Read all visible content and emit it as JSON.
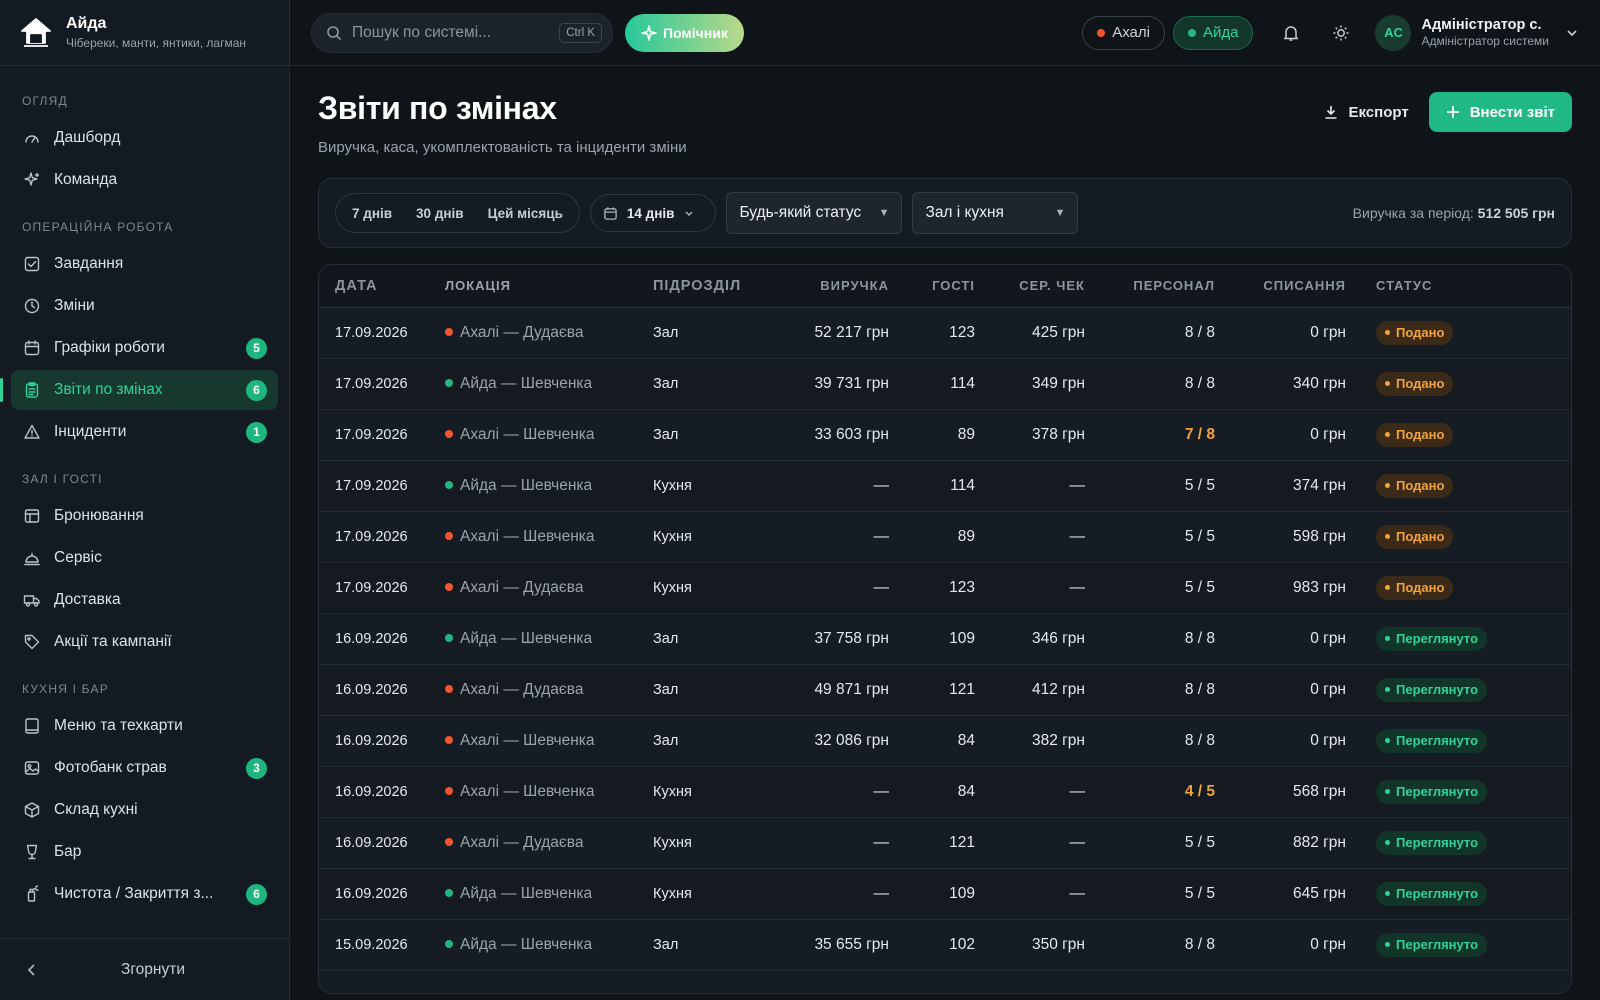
{
  "brand": {
    "name": "Айда",
    "subtitle": "Чібереки, манти, янтики, лагман"
  },
  "search": {
    "placeholder": "Пошук по системі...",
    "shortcut": "Ctrl K"
  },
  "assistant_label": "Помічник",
  "locations": [
    {
      "label": "Ахалі",
      "color": "#f0562e",
      "active": false
    },
    {
      "label": "Айда",
      "color": "#22b57d",
      "active": true
    }
  ],
  "user": {
    "initials": "AC",
    "name": "Адміністратор с.",
    "role": "Адміністратор системи"
  },
  "sidebar": {
    "sections": [
      {
        "title": "ОГЛЯД",
        "items": [
          {
            "label": "Дашборд",
            "icon": "gauge-icon"
          },
          {
            "label": "Команда",
            "icon": "sparkle-icon"
          }
        ]
      },
      {
        "title": "ОПЕРАЦІЙНА РОБОТА",
        "items": [
          {
            "label": "Завдання",
            "icon": "checkbox-icon"
          },
          {
            "label": "Зміни",
            "icon": "clock-icon"
          },
          {
            "label": "Графіки роботи",
            "icon": "calendar-icon",
            "badge": "5"
          },
          {
            "label": "Звіти по змінах",
            "icon": "clipboard-icon",
            "badge": "6",
            "active": true
          },
          {
            "label": "Інциденти",
            "icon": "warning-icon",
            "badge": "1"
          }
        ]
      },
      {
        "title": "ЗАЛ І ГОСТІ",
        "items": [
          {
            "label": "Бронювання",
            "icon": "table-icon"
          },
          {
            "label": "Сервіс",
            "icon": "cloche-icon"
          },
          {
            "label": "Доставка",
            "icon": "truck-icon"
          },
          {
            "label": "Акції та кампанії",
            "icon": "tag-icon"
          }
        ]
      },
      {
        "title": "КУХНЯ І БАР",
        "items": [
          {
            "label": "Меню та техкарти",
            "icon": "book-icon"
          },
          {
            "label": "Фотобанк страв",
            "icon": "image-icon",
            "badge": "3"
          },
          {
            "label": "Склад кухні",
            "icon": "box-icon"
          },
          {
            "label": "Бар",
            "icon": "glass-icon"
          },
          {
            "label": "Чистота / Закриття з...",
            "icon": "spray-icon",
            "badge": "6"
          }
        ]
      }
    ],
    "collapse_label": "Згорнути"
  },
  "page": {
    "title": "Звіти по змінах",
    "subtitle": "Виручка, каса, укомплектованість та інциденти зміни",
    "export_label": "Експорт",
    "primary_label": "Внести звіт"
  },
  "filters": {
    "ranges": [
      "7 днів",
      "30 днів",
      "Цей місяць"
    ],
    "date_value": "14 днів",
    "status_value": "Будь-який статус",
    "dept_value": "Зал і кухня",
    "summary_label": "Виручка за період:",
    "summary_value": "512 505 грн"
  },
  "table": {
    "headers": [
      "ДАТА",
      "ЛОКАЦІЯ",
      "ПІДРОЗДІЛ",
      "ВИРУЧКА",
      "ГОСТІ",
      "СЕР. ЧЕК",
      "ПЕРСОНАЛ",
      "СПИСАННЯ",
      "СТАТУС"
    ],
    "rows": [
      {
        "date": "17.09.2026",
        "loc": "Ахалі — Дудаєва",
        "loc_color": "#f0562e",
        "dept": "Зал",
        "revenue": "52 217 грн",
        "guests": "123",
        "check": "425 грн",
        "staff": "8 / 8",
        "staff_warn": false,
        "writeoff": "0 грн",
        "status": "Подано",
        "status_kind": "submitted"
      },
      {
        "date": "17.09.2026",
        "loc": "Айда — Шевченка",
        "loc_color": "#22b57d",
        "dept": "Зал",
        "revenue": "39 731 грн",
        "guests": "114",
        "check": "349 грн",
        "staff": "8 / 8",
        "staff_warn": false,
        "writeoff": "340 грн",
        "status": "Подано",
        "status_kind": "submitted"
      },
      {
        "date": "17.09.2026",
        "loc": "Ахалі — Шевченка",
        "loc_color": "#f0562e",
        "dept": "Зал",
        "revenue": "33 603 грн",
        "guests": "89",
        "check": "378 грн",
        "staff": "7 / 8",
        "staff_warn": true,
        "writeoff": "0 грн",
        "status": "Подано",
        "status_kind": "submitted"
      },
      {
        "date": "17.09.2026",
        "loc": "Айда — Шевченка",
        "loc_color": "#22b57d",
        "dept": "Кухня",
        "revenue": "—",
        "guests": "114",
        "check": "—",
        "staff": "5 / 5",
        "staff_warn": false,
        "writeoff": "374 грн",
        "status": "Подано",
        "status_kind": "submitted"
      },
      {
        "date": "17.09.2026",
        "loc": "Ахалі — Шевченка",
        "loc_color": "#f0562e",
        "dept": "Кухня",
        "revenue": "—",
        "guests": "89",
        "check": "—",
        "staff": "5 / 5",
        "staff_warn": false,
        "writeoff": "598 грн",
        "status": "Подано",
        "status_kind": "submitted"
      },
      {
        "date": "17.09.2026",
        "loc": "Ахалі — Дудаєва",
        "loc_color": "#f0562e",
        "dept": "Кухня",
        "revenue": "—",
        "guests": "123",
        "check": "—",
        "staff": "5 / 5",
        "staff_warn": false,
        "writeoff": "983 грн",
        "status": "Подано",
        "status_kind": "submitted"
      },
      {
        "date": "16.09.2026",
        "loc": "Айда — Шевченка",
        "loc_color": "#22b57d",
        "dept": "Зал",
        "revenue": "37 758 грн",
        "guests": "109",
        "check": "346 грн",
        "staff": "8 / 8",
        "staff_warn": false,
        "writeoff": "0 грн",
        "status": "Переглянуто",
        "status_kind": "reviewed"
      },
      {
        "date": "16.09.2026",
        "loc": "Ахалі — Дудаєва",
        "loc_color": "#f0562e",
        "dept": "Зал",
        "revenue": "49 871 грн",
        "guests": "121",
        "check": "412 грн",
        "staff": "8 / 8",
        "staff_warn": false,
        "writeoff": "0 грн",
        "status": "Переглянуто",
        "status_kind": "reviewed"
      },
      {
        "date": "16.09.2026",
        "loc": "Ахалі — Шевченка",
        "loc_color": "#f0562e",
        "dept": "Зал",
        "revenue": "32 086 грн",
        "guests": "84",
        "check": "382 грн",
        "staff": "8 / 8",
        "staff_warn": false,
        "writeoff": "0 грн",
        "status": "Переглянуто",
        "status_kind": "reviewed"
      },
      {
        "date": "16.09.2026",
        "loc": "Ахалі — Шевченка",
        "loc_color": "#f0562e",
        "dept": "Кухня",
        "revenue": "—",
        "guests": "84",
        "check": "—",
        "staff": "4 / 5",
        "staff_warn": true,
        "writeoff": "568 грн",
        "status": "Переглянуто",
        "status_kind": "reviewed"
      },
      {
        "date": "16.09.2026",
        "loc": "Ахалі — Дудаєва",
        "loc_color": "#f0562e",
        "dept": "Кухня",
        "revenue": "—",
        "guests": "121",
        "check": "—",
        "staff": "5 / 5",
        "staff_warn": false,
        "writeoff": "882 грн",
        "status": "Переглянуто",
        "status_kind": "reviewed"
      },
      {
        "date": "16.09.2026",
        "loc": "Айда — Шевченка",
        "loc_color": "#22b57d",
        "dept": "Кухня",
        "revenue": "—",
        "guests": "109",
        "check": "—",
        "staff": "5 / 5",
        "staff_warn": false,
        "writeoff": "645 грн",
        "status": "Переглянуто",
        "status_kind": "reviewed"
      },
      {
        "date": "15.09.2026",
        "loc": "Айда — Шевченка",
        "loc_color": "#22b57d",
        "dept": "Зал",
        "revenue": "35 655 грн",
        "guests": "102",
        "check": "350 грн",
        "staff": "8 / 8",
        "staff_warn": false,
        "writeoff": "0 грн",
        "status": "Переглянуто",
        "status_kind": "reviewed"
      }
    ]
  }
}
